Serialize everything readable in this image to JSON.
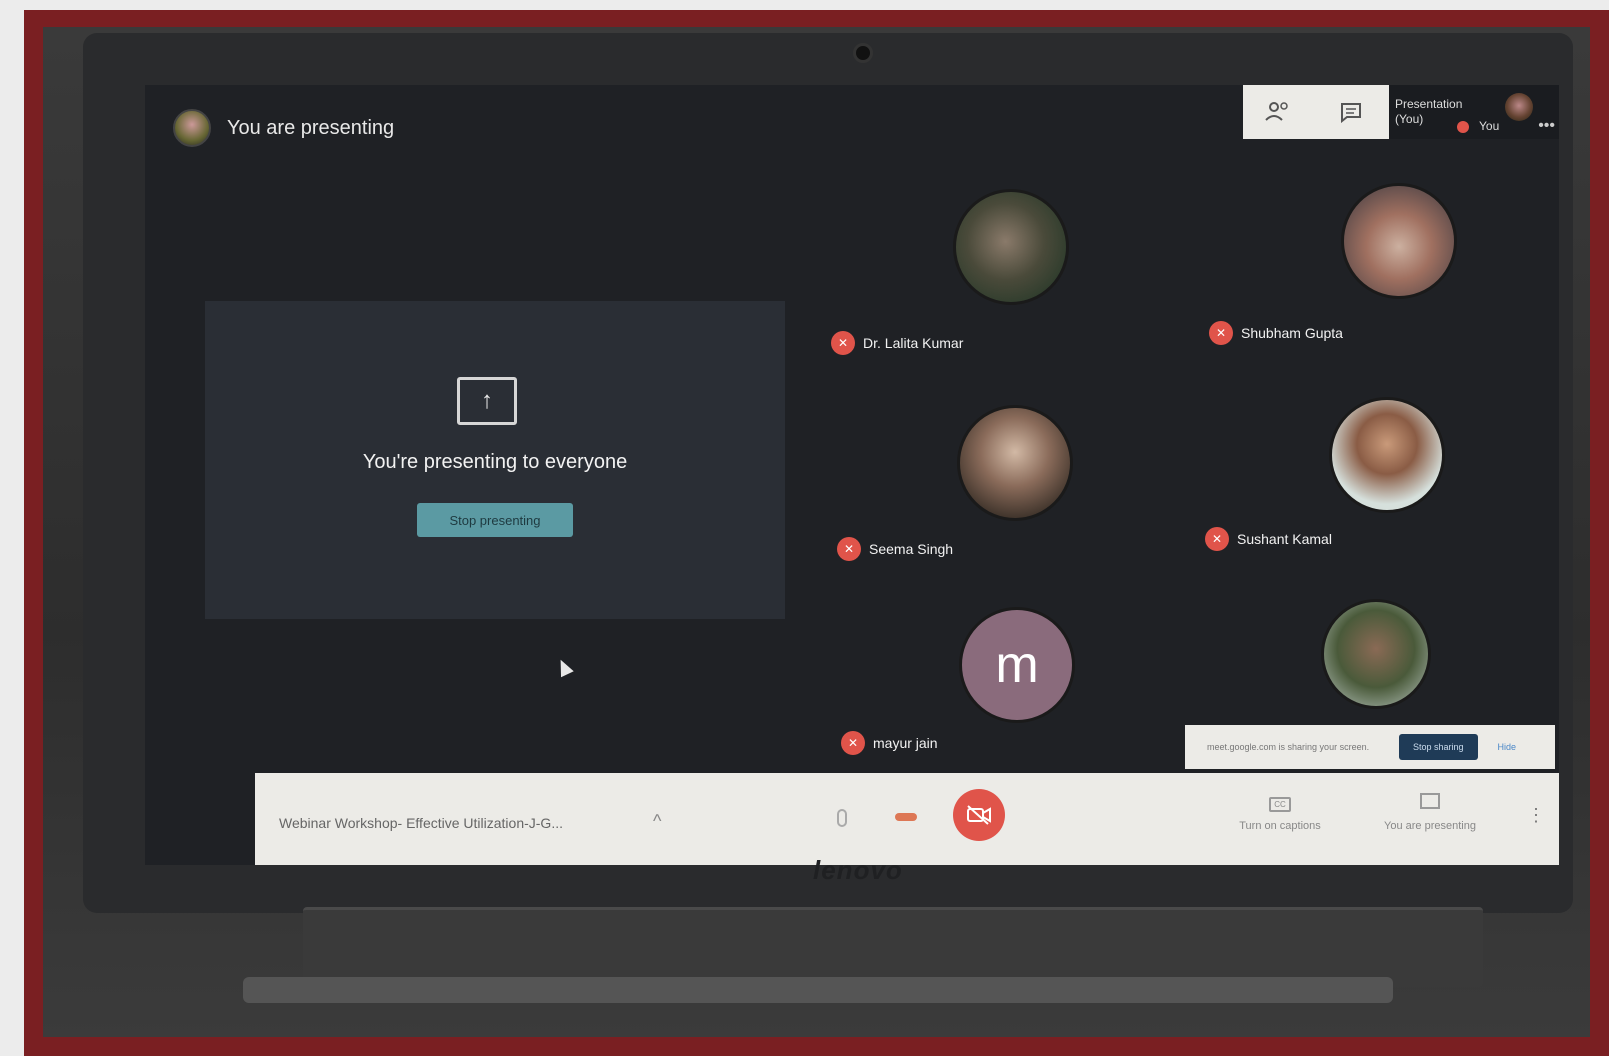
{
  "header": {
    "presenting_title": "You are presenting",
    "presentation_tile": "Presentation (You)",
    "you_tile": "You"
  },
  "presentation": {
    "message": "You're presenting to everyone",
    "stop_button": "Stop presenting"
  },
  "participants": [
    {
      "name": "Dr. Lalita Kumar",
      "avatar": "photo"
    },
    {
      "name": "Shubham Gupta",
      "avatar": "photo"
    },
    {
      "name": "Seema Singh",
      "avatar": "photo"
    },
    {
      "name": "Sushant Kamal",
      "avatar": "photo"
    },
    {
      "name": "mayur jain",
      "avatar_letter": "m"
    },
    {
      "name": "",
      "avatar": "photo"
    }
  ],
  "share_notice": {
    "message": "meet.google.com is sharing your screen.",
    "stop_button": "Stop sharing",
    "hide": "Hide"
  },
  "bottom_bar": {
    "meeting_title": "Webinar Workshop- Effective Utilization-J-G...",
    "captions_label": "Turn on captions",
    "captions_icon": "CC",
    "present_label": "You are presenting"
  },
  "device": {
    "brand": "lenovo"
  },
  "colors": {
    "frame": "#7a1f22",
    "mute_red": "#e0544a",
    "stop_presenting": "#5b9aa3",
    "stop_sharing": "#1f3b57"
  }
}
